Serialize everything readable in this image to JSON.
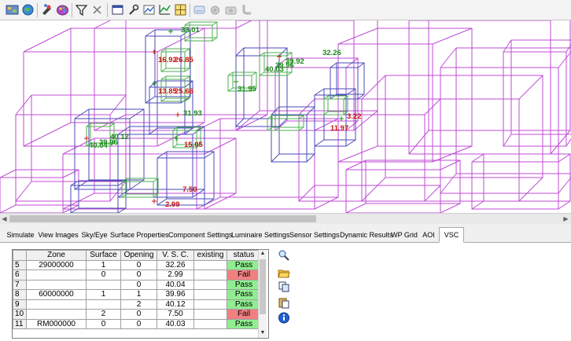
{
  "tabs": [
    "Simulate",
    "View Images",
    "Sky/Eye",
    "Surface Properties",
    "Component Settings",
    "Luminaire Settings",
    "Sensor Settings",
    "Dynamic Results",
    "WP Grid",
    "AOI",
    "VSC"
  ],
  "active_tab": "VSC",
  "model_labels": [
    {
      "text": "33.01",
      "color": "green"
    },
    {
      "text": "16.92",
      "color": "red"
    },
    {
      "text": "26.85",
      "color": "red"
    },
    {
      "text": "32.26",
      "color": "green"
    },
    {
      "text": "39.92",
      "color": "green"
    },
    {
      "text": "39.96",
      "color": "green"
    },
    {
      "text": "40.03",
      "color": "green"
    },
    {
      "text": "13.85",
      "color": "red"
    },
    {
      "text": "25.66",
      "color": "red"
    },
    {
      "text": "31.95",
      "color": "green"
    },
    {
      "text": "31.93",
      "color": "green"
    },
    {
      "text": "3.22",
      "color": "red"
    },
    {
      "text": "11.97",
      "color": "red"
    },
    {
      "text": "40.12",
      "color": "green"
    },
    {
      "text": "39.96",
      "color": "green"
    },
    {
      "text": "40.04",
      "color": "green"
    },
    {
      "text": "15.05",
      "color": "red"
    },
    {
      "text": "7.50",
      "color": "red"
    },
    {
      "text": "2.99",
      "color": "red"
    }
  ],
  "label_colors": {
    "green": "#1a8a1a",
    "red": "#c81414"
  },
  "wire_colors": {
    "magenta": "#c04bd6",
    "blue": "#4a4ab8",
    "green": "#4caf50"
  },
  "table": {
    "columns": [
      "",
      "Zone",
      "Surface",
      "Opening",
      "V. S. C.",
      "existing",
      "status"
    ],
    "rows": [
      {
        "num": "5",
        "zone": "29000000",
        "surface": "1",
        "opening": "0",
        "vsc": "32.26",
        "existing": "",
        "status": "Pass"
      },
      {
        "num": "6",
        "zone": "",
        "surface": "0",
        "opening": "0",
        "vsc": "2.99",
        "existing": "",
        "status": "Fail"
      },
      {
        "num": "7",
        "zone": "",
        "surface": "",
        "opening": "0",
        "vsc": "40.04",
        "existing": "",
        "status": "Pass"
      },
      {
        "num": "8",
        "zone": "60000000",
        "surface": "1",
        "opening": "1",
        "vsc": "39.96",
        "existing": "",
        "status": "Pass"
      },
      {
        "num": "9",
        "zone": "",
        "surface": "",
        "opening": "2",
        "vsc": "40.12",
        "existing": "",
        "status": "Pass"
      },
      {
        "num": "10",
        "zone": "",
        "surface": "2",
        "opening": "0",
        "vsc": "7.50",
        "existing": "",
        "status": "Fail"
      },
      {
        "num": "11",
        "zone": "RM000000",
        "surface": "0",
        "opening": "0",
        "vsc": "40.03",
        "existing": "",
        "status": "Pass"
      }
    ]
  },
  "status_colors": {
    "Pass": "#90ee90",
    "Fail": "#f08080"
  },
  "toolbar_icons": [
    "map-icon",
    "globe-icon",
    "paint-icon",
    "palette-icon",
    "filter-icon",
    "close-icon",
    "window-icon",
    "wrench-icon",
    "chart-icon",
    "graph-icon",
    "grid-icon",
    "sky-icon",
    "sensor-icon",
    "camera-icon",
    "clear-icon",
    "pipe-icon"
  ],
  "side_buttons": [
    "zoom-icon",
    "open-folder-icon",
    "copy-icon",
    "paste-icon",
    "info-icon"
  ]
}
